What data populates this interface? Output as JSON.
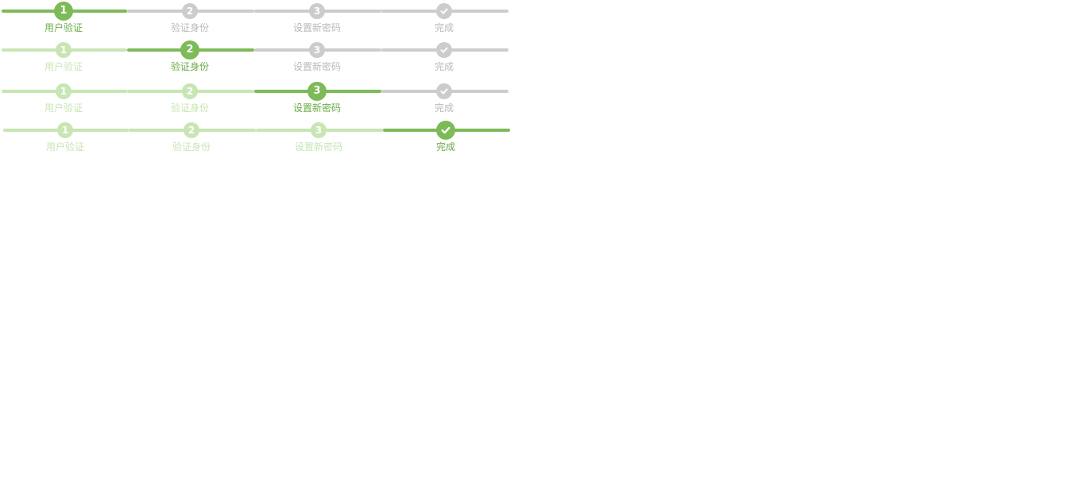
{
  "colors": {
    "done": "#c7e6b4",
    "active": "#7dba58",
    "pending": "#cccccc",
    "active_text": "#6aab46",
    "pending_text": "#b9b9b9",
    "node_text": "#ffffff"
  },
  "steps": [
    {
      "num": "1",
      "label": "用户验证"
    },
    {
      "num": "2",
      "label": "验证身份"
    },
    {
      "num": "3",
      "label": "设置新密码"
    },
    {
      "num": "",
      "label": "完成",
      "icon": "check-icon"
    }
  ],
  "steppers": [
    {
      "current_step": 1
    },
    {
      "current_step": 2
    },
    {
      "current_step": 3
    },
    {
      "current_step": 4
    }
  ]
}
